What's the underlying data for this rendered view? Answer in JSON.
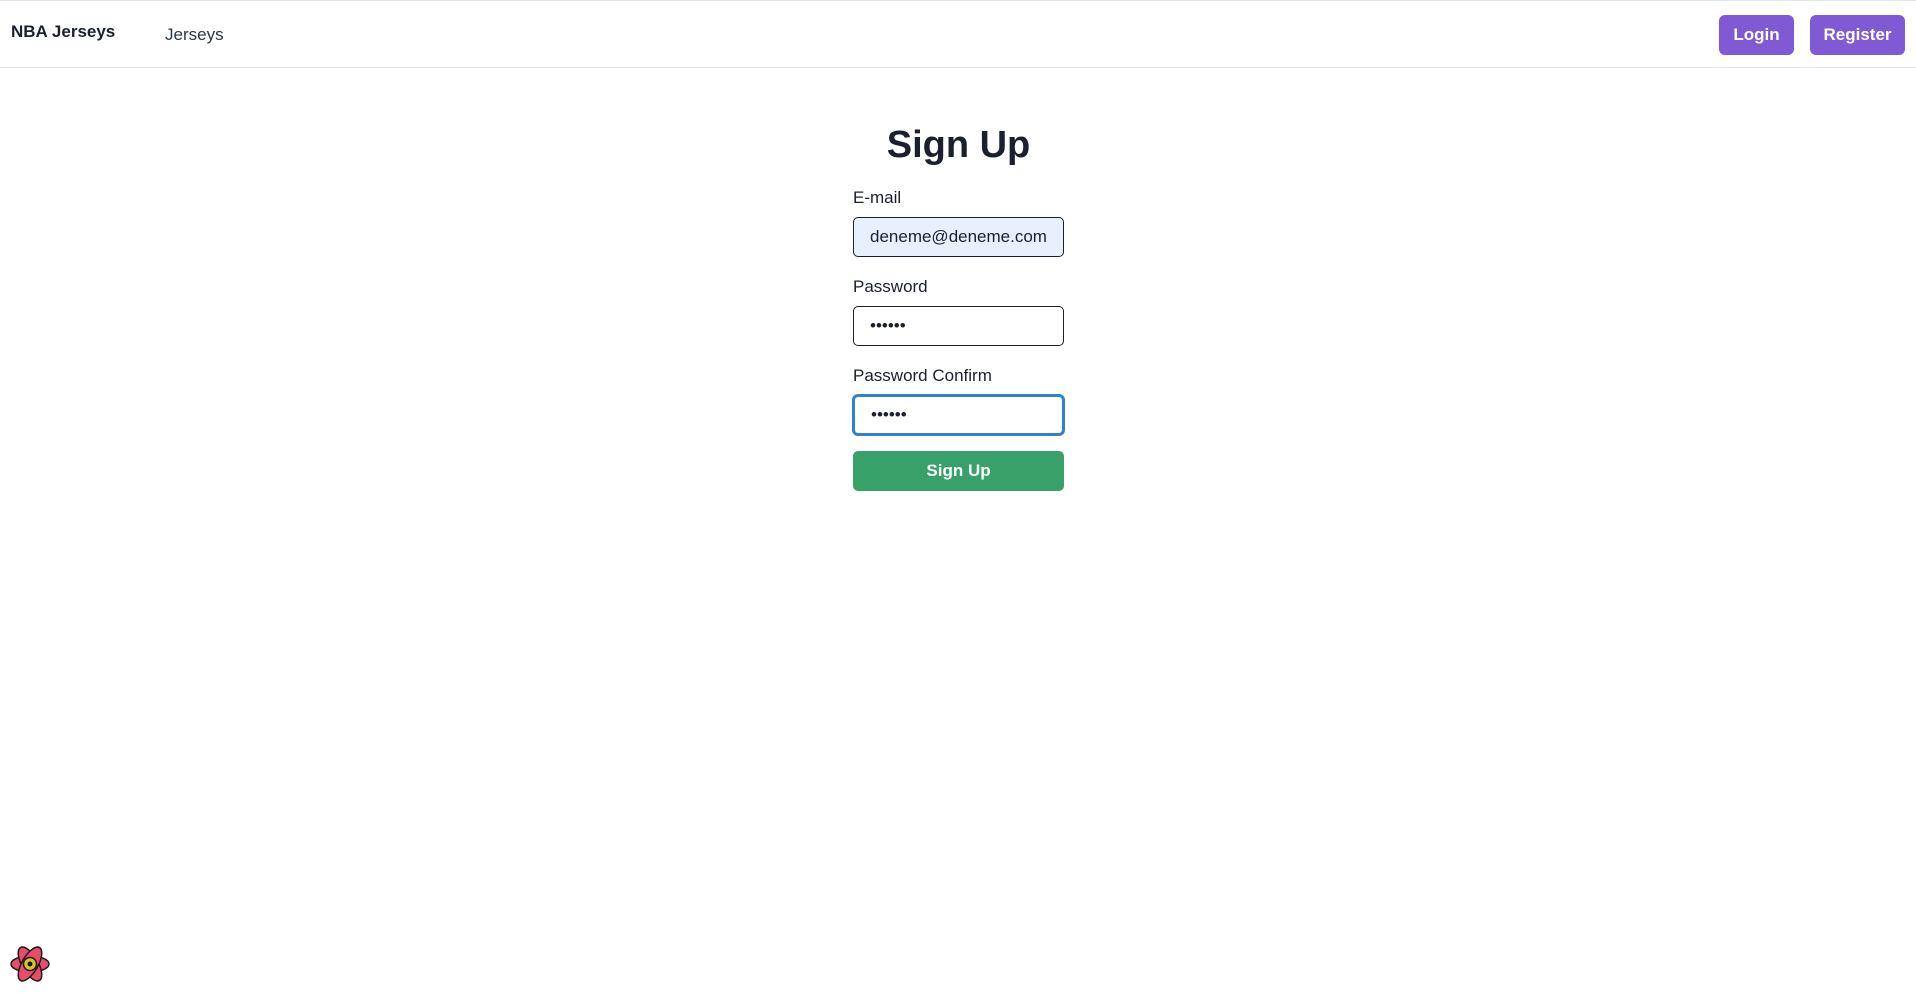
{
  "navbar": {
    "brand": "NBA Jerseys",
    "links": [
      "Jerseys"
    ],
    "login_label": "Login",
    "register_label": "Register",
    "button_color": "#805ad5"
  },
  "signup": {
    "title": "Sign Up",
    "email_label": "E-mail",
    "email_value": "deneme@deneme.com",
    "password_label": "Password",
    "password_value": "••••••",
    "password_confirm_label": "Password Confirm",
    "password_confirm_value": "••••••",
    "submit_label": "Sign Up",
    "submit_color": "#38a169",
    "focus_color": "#3182ce"
  },
  "devtools": {
    "icon": "react-devtools-icon"
  }
}
